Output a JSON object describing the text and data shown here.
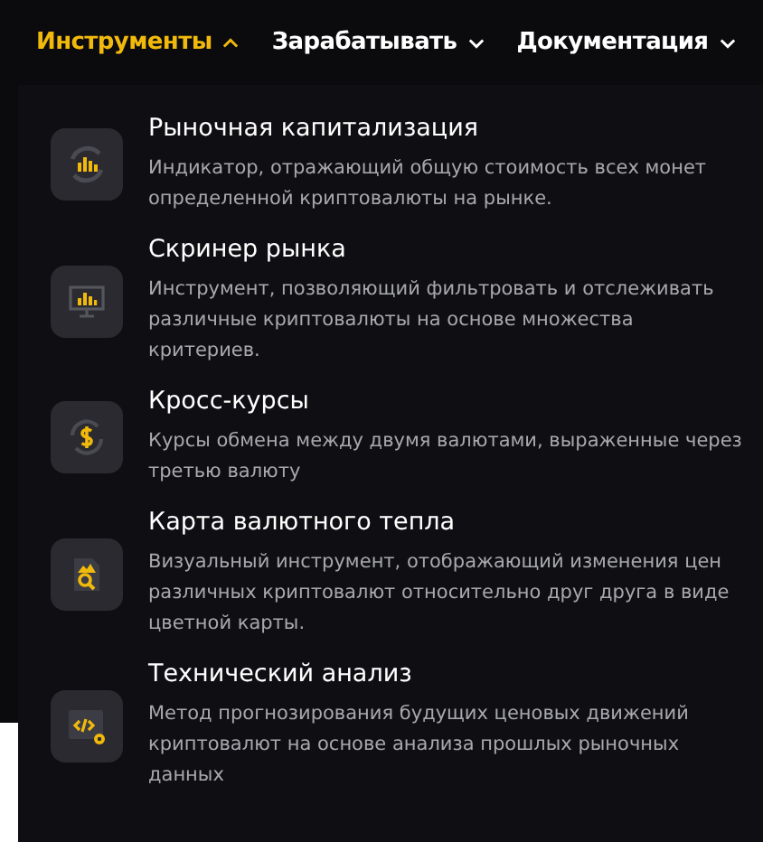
{
  "nav": [
    {
      "label": "Инструменты",
      "selected": true,
      "expanded": true
    },
    {
      "label": "Зарабатывать",
      "selected": false,
      "expanded": false
    },
    {
      "label": "Документация",
      "selected": false,
      "expanded": false
    }
  ],
  "background_fragments": [
    {
      "kind": "box"
    }
  ],
  "menu_items": [
    {
      "title": "Рыночная капитализация",
      "description": "Индикатор, отражающий общую стоимость всех монет определенной криптовалюты на рынке."
    },
    {
      "title": "Скринер рынка",
      "description": "Инструмент, позволяющий фильтровать и отслеживать различные криптовалюты на основе множества критериев."
    },
    {
      "title": "Кросс-курсы",
      "description": "Курсы обмена между двумя валютами, выраженные через третью валюту"
    },
    {
      "title": "Карта валютного тепла",
      "description": "Визуальный инструмент, отображающий изменения цен различных криптовалют относительно друг друга в виде цветной карты."
    },
    {
      "title": "Технический анализ",
      "description": "Метод прогнозирования будущих ценовых движений криптовалют на основе анализа прошлых рыночных данных"
    }
  ]
}
